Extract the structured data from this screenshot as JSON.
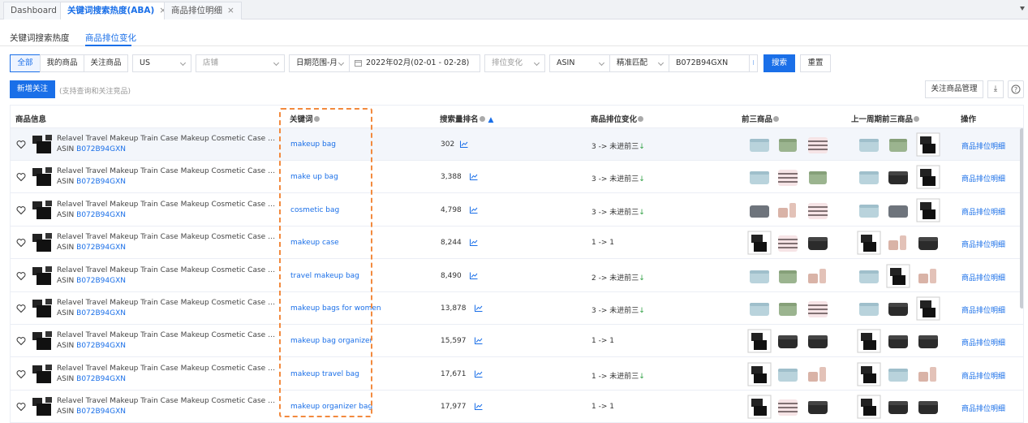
{
  "tabs": [
    {
      "label": "Dashboard",
      "active": false,
      "closable": false
    },
    {
      "label": "关键词搜索热度(ABA)",
      "active": true,
      "closable": true
    },
    {
      "label": "商品排位明细",
      "active": false,
      "closable": true
    }
  ],
  "subtabs": [
    {
      "label": "关键词搜索热度",
      "active": false
    },
    {
      "label": "商品排位变化",
      "active": true
    }
  ],
  "filters": {
    "scope": [
      "全部",
      "我的商品",
      "关注商品"
    ],
    "scope_selected": "全部",
    "marketplace": "US",
    "store_placeholder": "店铺",
    "date_range_type": "日期范围-月",
    "date_value": "2022年02月(02-01 - 02-28)",
    "rank_change_placeholder": "排位变化",
    "id_type": "ASIN",
    "match_type": "精准匹配",
    "search_value": "B072B94GXN",
    "search_button": "搜索",
    "reset_button": "重置"
  },
  "toolbar": {
    "add_follow": "新增关注",
    "add_follow_hint": "(支持查询和关注竞品)",
    "manage_button": "关注商品管理",
    "download_icon": "download-icon",
    "help_icon": "help-icon"
  },
  "table": {
    "headers": {
      "product": "商品信息",
      "keyword": "关键词",
      "search_rank": "搜索量排名",
      "rank_change": "商品排位变化",
      "top3": "前三商品",
      "prev_top3": "上一周期前三商品",
      "action": "操作"
    },
    "rows": [
      {
        "title": "Relavel Travel Makeup Train Case Makeup Cosmetic Case Organizer Porta...",
        "asin_label": "ASIN",
        "asin": "B072B94GXN",
        "keyword": "makeup bag",
        "rank": "302",
        "change": "3 -> 未进前三",
        "arrow": true,
        "top3": [
          "blue",
          "green",
          "pink-stripe"
        ],
        "prev": [
          "blue",
          "green",
          "black-open"
        ],
        "action": "商品排位明细"
      },
      {
        "title": "Relavel Travel Makeup Train Case Makeup Cosmetic Case Organizer Porta...",
        "asin_label": "ASIN",
        "asin": "B072B94GXN",
        "keyword": "make up bag",
        "rank": "3,388",
        "change": "3 -> 未进前三",
        "arrow": true,
        "top3": [
          "blue",
          "pink-stripe",
          "green"
        ],
        "prev": [
          "blue",
          "black",
          "black-open"
        ],
        "action": "商品排位明细"
      },
      {
        "title": "Relavel Travel Makeup Train Case Makeup Cosmetic Case Organizer Porta...",
        "asin_label": "ASIN",
        "asin": "B072B94GXN",
        "keyword": "cosmetic bag",
        "rank": "4,798",
        "change": "3 -> 未进前三",
        "arrow": true,
        "top3": [
          "gray",
          "pink-set",
          "pink-stripe"
        ],
        "prev": [
          "blue",
          "gray",
          "black-open"
        ],
        "action": "商品排位明细"
      },
      {
        "title": "Relavel Travel Makeup Train Case Makeup Cosmetic Case Organizer Porta...",
        "asin_label": "ASIN",
        "asin": "B072B94GXN",
        "keyword": "makeup case",
        "rank": "8,244",
        "change": "1 -> 1",
        "arrow": false,
        "top3": [
          "black-open",
          "pink-stripe",
          "black"
        ],
        "prev": [
          "black-open",
          "pink-set",
          "black"
        ],
        "action": "商品排位明细"
      },
      {
        "title": "Relavel Travel Makeup Train Case Makeup Cosmetic Case Organizer Porta...",
        "asin_label": "ASIN",
        "asin": "B072B94GXN",
        "keyword": "travel makeup bag",
        "rank": "8,490",
        "change": "2 -> 未进前三",
        "arrow": true,
        "top3": [
          "blue",
          "green",
          "pink-set"
        ],
        "prev": [
          "blue",
          "black-open",
          "pink-set"
        ],
        "action": "商品排位明细"
      },
      {
        "title": "Relavel Travel Makeup Train Case Makeup Cosmetic Case Organizer Porta...",
        "asin_label": "ASIN",
        "asin": "B072B94GXN",
        "keyword": "makeup bags for women",
        "rank": "13,878",
        "change": "3 -> 未进前三",
        "arrow": true,
        "top3": [
          "blue",
          "green",
          "pink-stripe"
        ],
        "prev": [
          "blue",
          "black",
          "black-open"
        ],
        "action": "商品排位明细"
      },
      {
        "title": "Relavel Travel Makeup Train Case Makeup Cosmetic Case Organizer Porta...",
        "asin_label": "ASIN",
        "asin": "B072B94GXN",
        "keyword": "makeup bag organizer",
        "rank": "15,597",
        "change": "1 -> 1",
        "arrow": false,
        "top3": [
          "black-open",
          "black",
          "black"
        ],
        "prev": [
          "black-open",
          "black",
          "black"
        ],
        "action": "商品排位明细"
      },
      {
        "title": "Relavel Travel Makeup Train Case Makeup Cosmetic Case Organizer Porta...",
        "asin_label": "ASIN",
        "asin": "B072B94GXN",
        "keyword": "makeup travel bag",
        "rank": "17,671",
        "change": "1 -> 未进前三",
        "arrow": true,
        "top3": [
          "black-open",
          "blue",
          "pink-set"
        ],
        "prev": [
          "black-open",
          "blue",
          "pink-set"
        ],
        "action": "商品排位明细"
      },
      {
        "title": "Relavel Travel Makeup Train Case Makeup Cosmetic Case Organizer Porta...",
        "asin_label": "ASIN",
        "asin": "B072B94GXN",
        "keyword": "makeup organizer bag",
        "rank": "17,977",
        "change": "1 -> 1",
        "arrow": false,
        "top3": [
          "black-open",
          "pink-stripe",
          "black"
        ],
        "prev": [
          "black-open",
          "black",
          "black"
        ],
        "action": "商品排位明细"
      }
    ]
  },
  "colors": {
    "accent": "#1a6fe8",
    "highlight": "#f28a3e"
  }
}
